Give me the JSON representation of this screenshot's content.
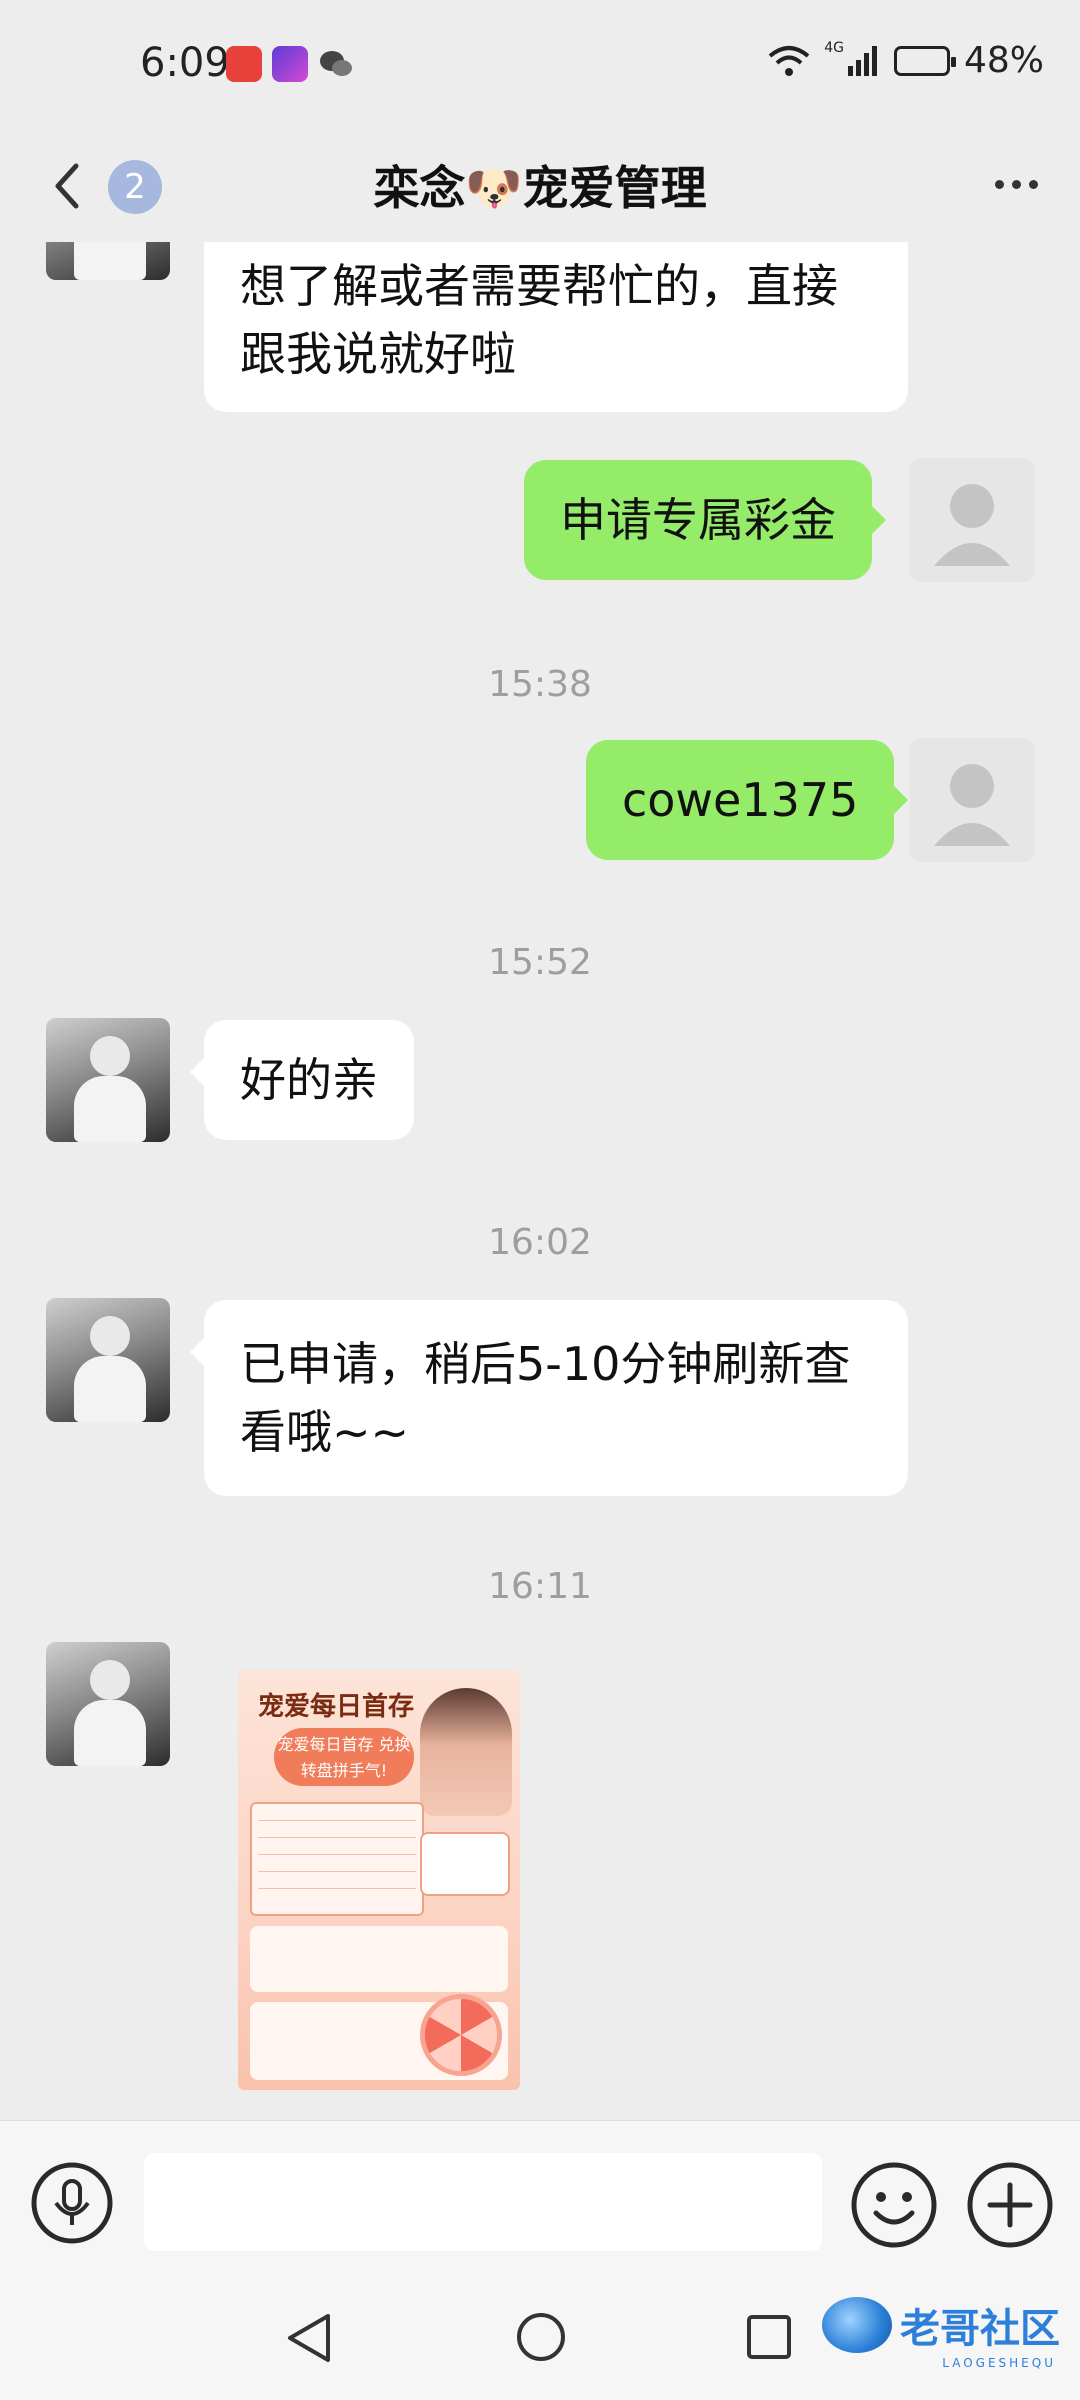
{
  "status_bar": {
    "time": "6:09",
    "network": "4G",
    "battery": "48%"
  },
  "header": {
    "unread_count": "2",
    "title": "栾念🐶宠爱管理"
  },
  "messages": [
    {
      "type": "text",
      "side": "in",
      "text": "想了解或者需要帮忙的，直接跟我说就好啦"
    },
    {
      "type": "text",
      "side": "out",
      "text": "申请专属彩金"
    },
    {
      "type": "time",
      "text": "15:38"
    },
    {
      "type": "text",
      "side": "out",
      "text": "cowe1375"
    },
    {
      "type": "time",
      "text": "15:52"
    },
    {
      "type": "text",
      "side": "in",
      "text": "好的亲"
    },
    {
      "type": "time",
      "text": "16:02"
    },
    {
      "type": "text",
      "side": "in",
      "text": "已申请，稍后5-10分钟刷新查看哦~~"
    },
    {
      "type": "time",
      "text": "16:11"
    },
    {
      "type": "image",
      "side": "in"
    }
  ],
  "poster": {
    "title": "宠爱每日首存",
    "banner": "宠爱每日首存 兑换转盘拼手气!"
  },
  "watermark": {
    "text": "老哥社区",
    "sub": "LAOGESHEQU"
  },
  "colors": {
    "background": "#ededed",
    "outgoing_bubble": "#95ec69",
    "incoming_bubble": "#ffffff",
    "timestamp": "#9e9e9e",
    "badge": "#a6b8de"
  },
  "icons": {
    "back": "chevron-left-icon",
    "more": "ellipsis-icon",
    "voice": "microphone-icon",
    "emoji": "smiley-icon",
    "plus": "plus-icon"
  }
}
